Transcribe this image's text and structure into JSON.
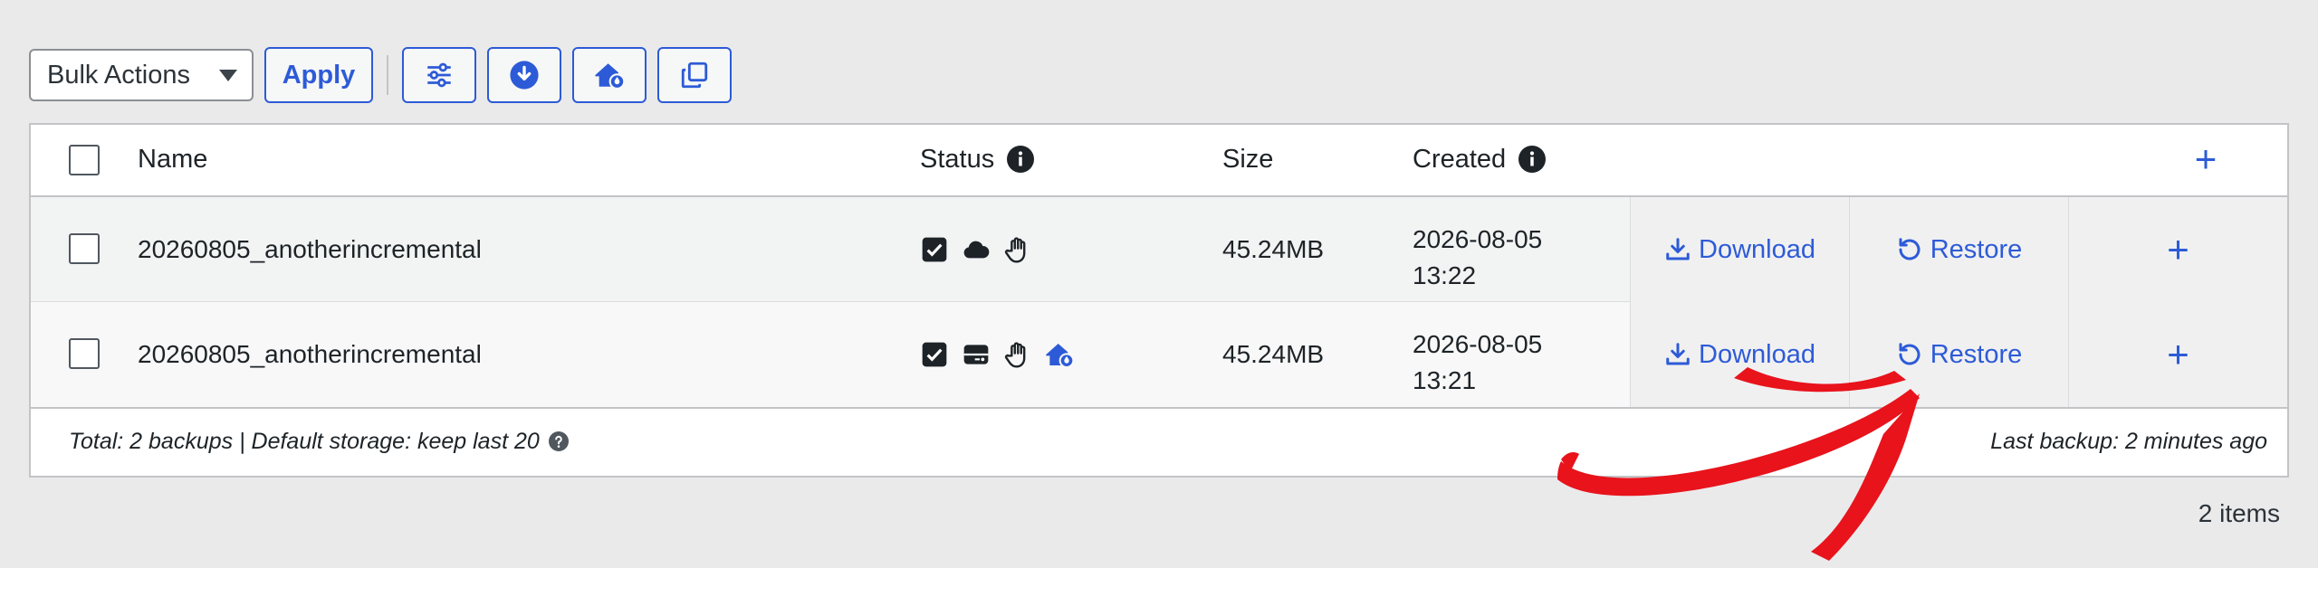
{
  "toolbar": {
    "bulk_actions_label": "Bulk Actions",
    "apply_label": "Apply",
    "icon_buttons": [
      "sliders-icon",
      "download-circle-icon",
      "home-storage-icon",
      "copy-icon"
    ]
  },
  "table": {
    "headers": {
      "name": "Name",
      "status": "Status",
      "size": "Size",
      "created": "Created"
    },
    "rows": [
      {
        "name": "20260805_anotherincremental",
        "status_icons": [
          "checkbox-checked-icon",
          "cloud-icon",
          "hand-icon"
        ],
        "size": "45.24MB",
        "created_date": "2026-08-05",
        "created_time": "13:22",
        "download_label": "Download",
        "restore_label": "Restore"
      },
      {
        "name": "20260805_anotherincremental",
        "status_icons": [
          "checkbox-checked-icon",
          "server-icon",
          "hand-icon",
          "home-storage-icon"
        ],
        "size": "45.24MB",
        "created_date": "2026-08-05",
        "created_time": "13:21",
        "download_label": "Download",
        "restore_label": "Restore"
      }
    ],
    "footer_left": "Total: 2 backups | Default storage: keep last 20",
    "footer_right": "Last backup: 2 minutes ago"
  },
  "items_count": "2 items",
  "colors": {
    "accent": "#2d5bd7",
    "annotation_arrow": "#e8131b",
    "background": "#eaeaeb"
  }
}
